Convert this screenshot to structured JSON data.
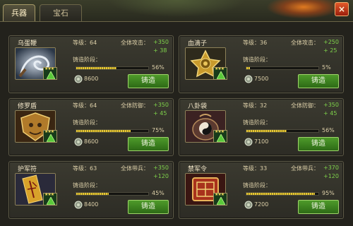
{
  "tabs": [
    {
      "label": "兵器",
      "active": true
    },
    {
      "label": "宝石",
      "active": false
    }
  ],
  "close_label": "×",
  "colors": {
    "accent_green": "#7ed24a",
    "bar_yellow": "#e8c935",
    "button_green": "#4e9a2a"
  },
  "items": [
    {
      "name": "乌蛋鞭",
      "level": "等级：64",
      "total_label": "全体攻击：",
      "total_value": "+350",
      "sub_label": "",
      "sub_value": "+ 38",
      "forge_label": "铸造阶段：",
      "progress_pct": "56%",
      "progress": 0.56,
      "cost": "8600",
      "button": "铸造",
      "icon": "whip-icon"
    },
    {
      "name": "血滴子",
      "level": "等级：36",
      "total_label": "全体攻击：",
      "total_value": "+250",
      "sub_label": "",
      "sub_value": "+ 25",
      "forge_label": "铸造阶段：",
      "progress_pct": "5%",
      "progress": 0.05,
      "cost": "7500",
      "button": "铸造",
      "icon": "blood-drop-icon"
    },
    {
      "name": "修罗盾",
      "level": "等级：64",
      "total_label": "全体防御：",
      "total_value": "+350",
      "sub_label": "",
      "sub_value": "+ 45",
      "forge_label": "铸造阶段：",
      "progress_pct": "75%",
      "progress": 0.75,
      "cost": "8600",
      "button": "铸造",
      "icon": "shield-icon"
    },
    {
      "name": "八卦袋",
      "level": "等级：32",
      "total_label": "全体防御：",
      "total_value": "+350",
      "sub_label": "",
      "sub_value": "+ 45",
      "forge_label": "铸造阶段：",
      "progress_pct": "56%",
      "progress": 0.56,
      "cost": "7100",
      "button": "铸造",
      "icon": "bagua-pouch-icon"
    },
    {
      "name": "护军符",
      "level": "等级：63",
      "total_label": "全体带兵：",
      "total_value": "+350",
      "sub_label": "",
      "sub_value": "+120",
      "forge_label": "铸造阶段：",
      "progress_pct": "45%",
      "progress": 0.45,
      "cost": "8400",
      "button": "铸造",
      "icon": "talisman-icon"
    },
    {
      "name": "禁军令",
      "level": "等级：33",
      "total_label": "全体带兵：",
      "total_value": "+370",
      "sub_label": "",
      "sub_value": "+120",
      "forge_label": "铸造阶段：",
      "progress_pct": "95%",
      "progress": 0.95,
      "cost": "7200",
      "button": "铸造",
      "icon": "command-token-icon"
    }
  ]
}
